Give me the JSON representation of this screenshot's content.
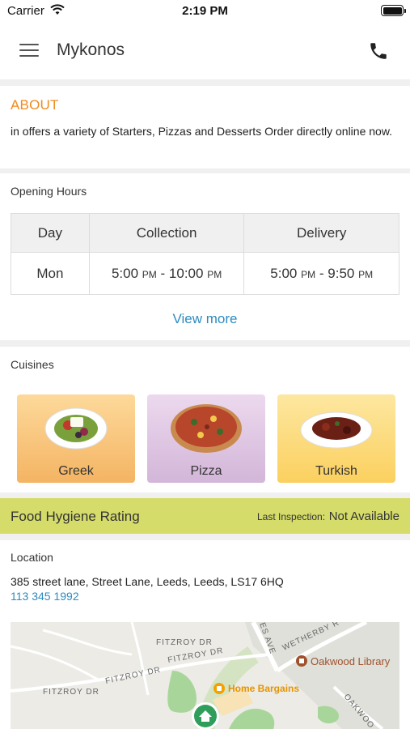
{
  "status_bar": {
    "carrier": "Carrier",
    "time": "2:19 PM"
  },
  "nav": {
    "title": "Mykonos",
    "menu_icon": "hamburger-menu-icon",
    "phone_icon": "phone-icon"
  },
  "about": {
    "heading": "ABOUT",
    "description": "in  offers a variety of Starters, Pizzas and Desserts Order directly online now."
  },
  "opening_hours": {
    "label": "Opening Hours",
    "columns": [
      "Day",
      "Collection",
      "Delivery"
    ],
    "rows": [
      {
        "day": "Mon",
        "collection_start": "5:00",
        "collection_start_ampm": "PM",
        "collection_end": "10:00",
        "collection_end_ampm": "PM",
        "delivery_start": "5:00",
        "delivery_start_ampm": "PM",
        "delivery_end": "9:50",
        "delivery_end_ampm": "PM"
      }
    ],
    "view_more": "View more"
  },
  "cuisines": {
    "label": "Cuisines",
    "items": [
      {
        "name": "Greek"
      },
      {
        "name": "Pizza"
      },
      {
        "name": "Turkish"
      }
    ]
  },
  "hygiene": {
    "label": "Food Hygiene Rating",
    "inspection_label": "Last Inspection:",
    "inspection_value": "Not Available"
  },
  "location": {
    "label": "Location",
    "address": "385 street lane, Street Lane, Leeds, Leeds, LS17 6HQ",
    "phone": "113 345 1992",
    "map": {
      "streets": [
        "FITZROY DR",
        "FITZROY DR",
        "FITZROY DR",
        "FITZROY DR",
        "WETHERBY R",
        "ES AVE",
        "OAKWOO"
      ],
      "poi_library": "Oakwood Library",
      "poi_store": "Home Bargains"
    }
  },
  "colors": {
    "accent_orange": "#f08a1d",
    "link_blue": "#2e8bc0",
    "hygiene_bar": "#d5dc6a",
    "map_pin_green": "#2f9e5a",
    "poi_brown": "#a0522d",
    "poi_orange": "#f4a100"
  }
}
